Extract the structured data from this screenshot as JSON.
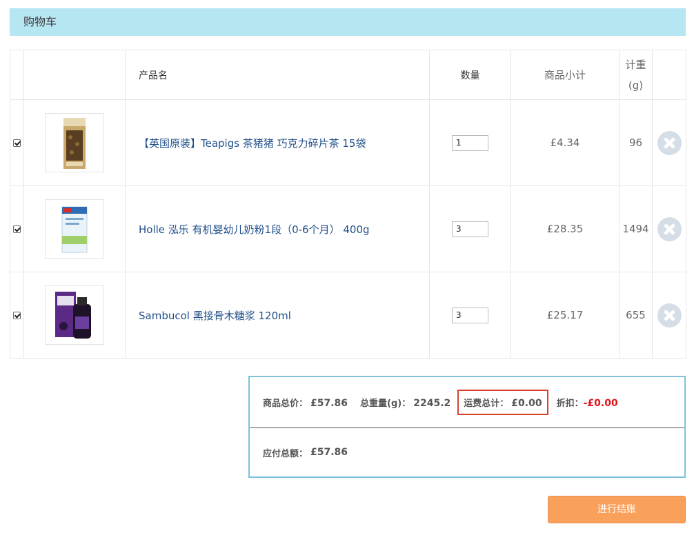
{
  "header": {
    "title": "购物车"
  },
  "table": {
    "columns": {
      "name": "产品名",
      "qty": "数量",
      "subtotal": "商品小计",
      "weight_line1": "计重",
      "weight_line2": "(g)"
    },
    "rows": [
      {
        "checked": true,
        "name": "【英国原装】Teapigs 茶猪猪 巧克力碎片茶 15袋",
        "qty": "1",
        "subtotal": "£4.34",
        "weight": "96"
      },
      {
        "checked": true,
        "name": "Holle 泓乐 有机婴幼儿奶粉1段（0-6个月） 400g",
        "qty": "3",
        "subtotal": "£28.35",
        "weight": "1494"
      },
      {
        "checked": true,
        "name": "Sambucol 黑接骨木糖浆 120ml",
        "qty": "3",
        "subtotal": "£25.17",
        "weight": "655"
      }
    ]
  },
  "summary": {
    "total_price_label": "商品总价：",
    "total_price": "£57.86",
    "total_weight_label": "总重量(g)：",
    "total_weight": "2245.2",
    "shipping_label": "运费总计：",
    "shipping": "£0.00",
    "discount_label": "折扣：",
    "discount": "-£0.00",
    "payable_label": "应付总额：",
    "payable": "£57.86"
  },
  "checkout_label": "进行结账",
  "colors": {
    "header_bg": "#b7e6f3",
    "link": "#1f4f8a",
    "summary_border": "#7fc1dd",
    "highlight_box": "#d9412e",
    "discount": "#e0151c",
    "checkout_bg": "#f9a05b"
  }
}
